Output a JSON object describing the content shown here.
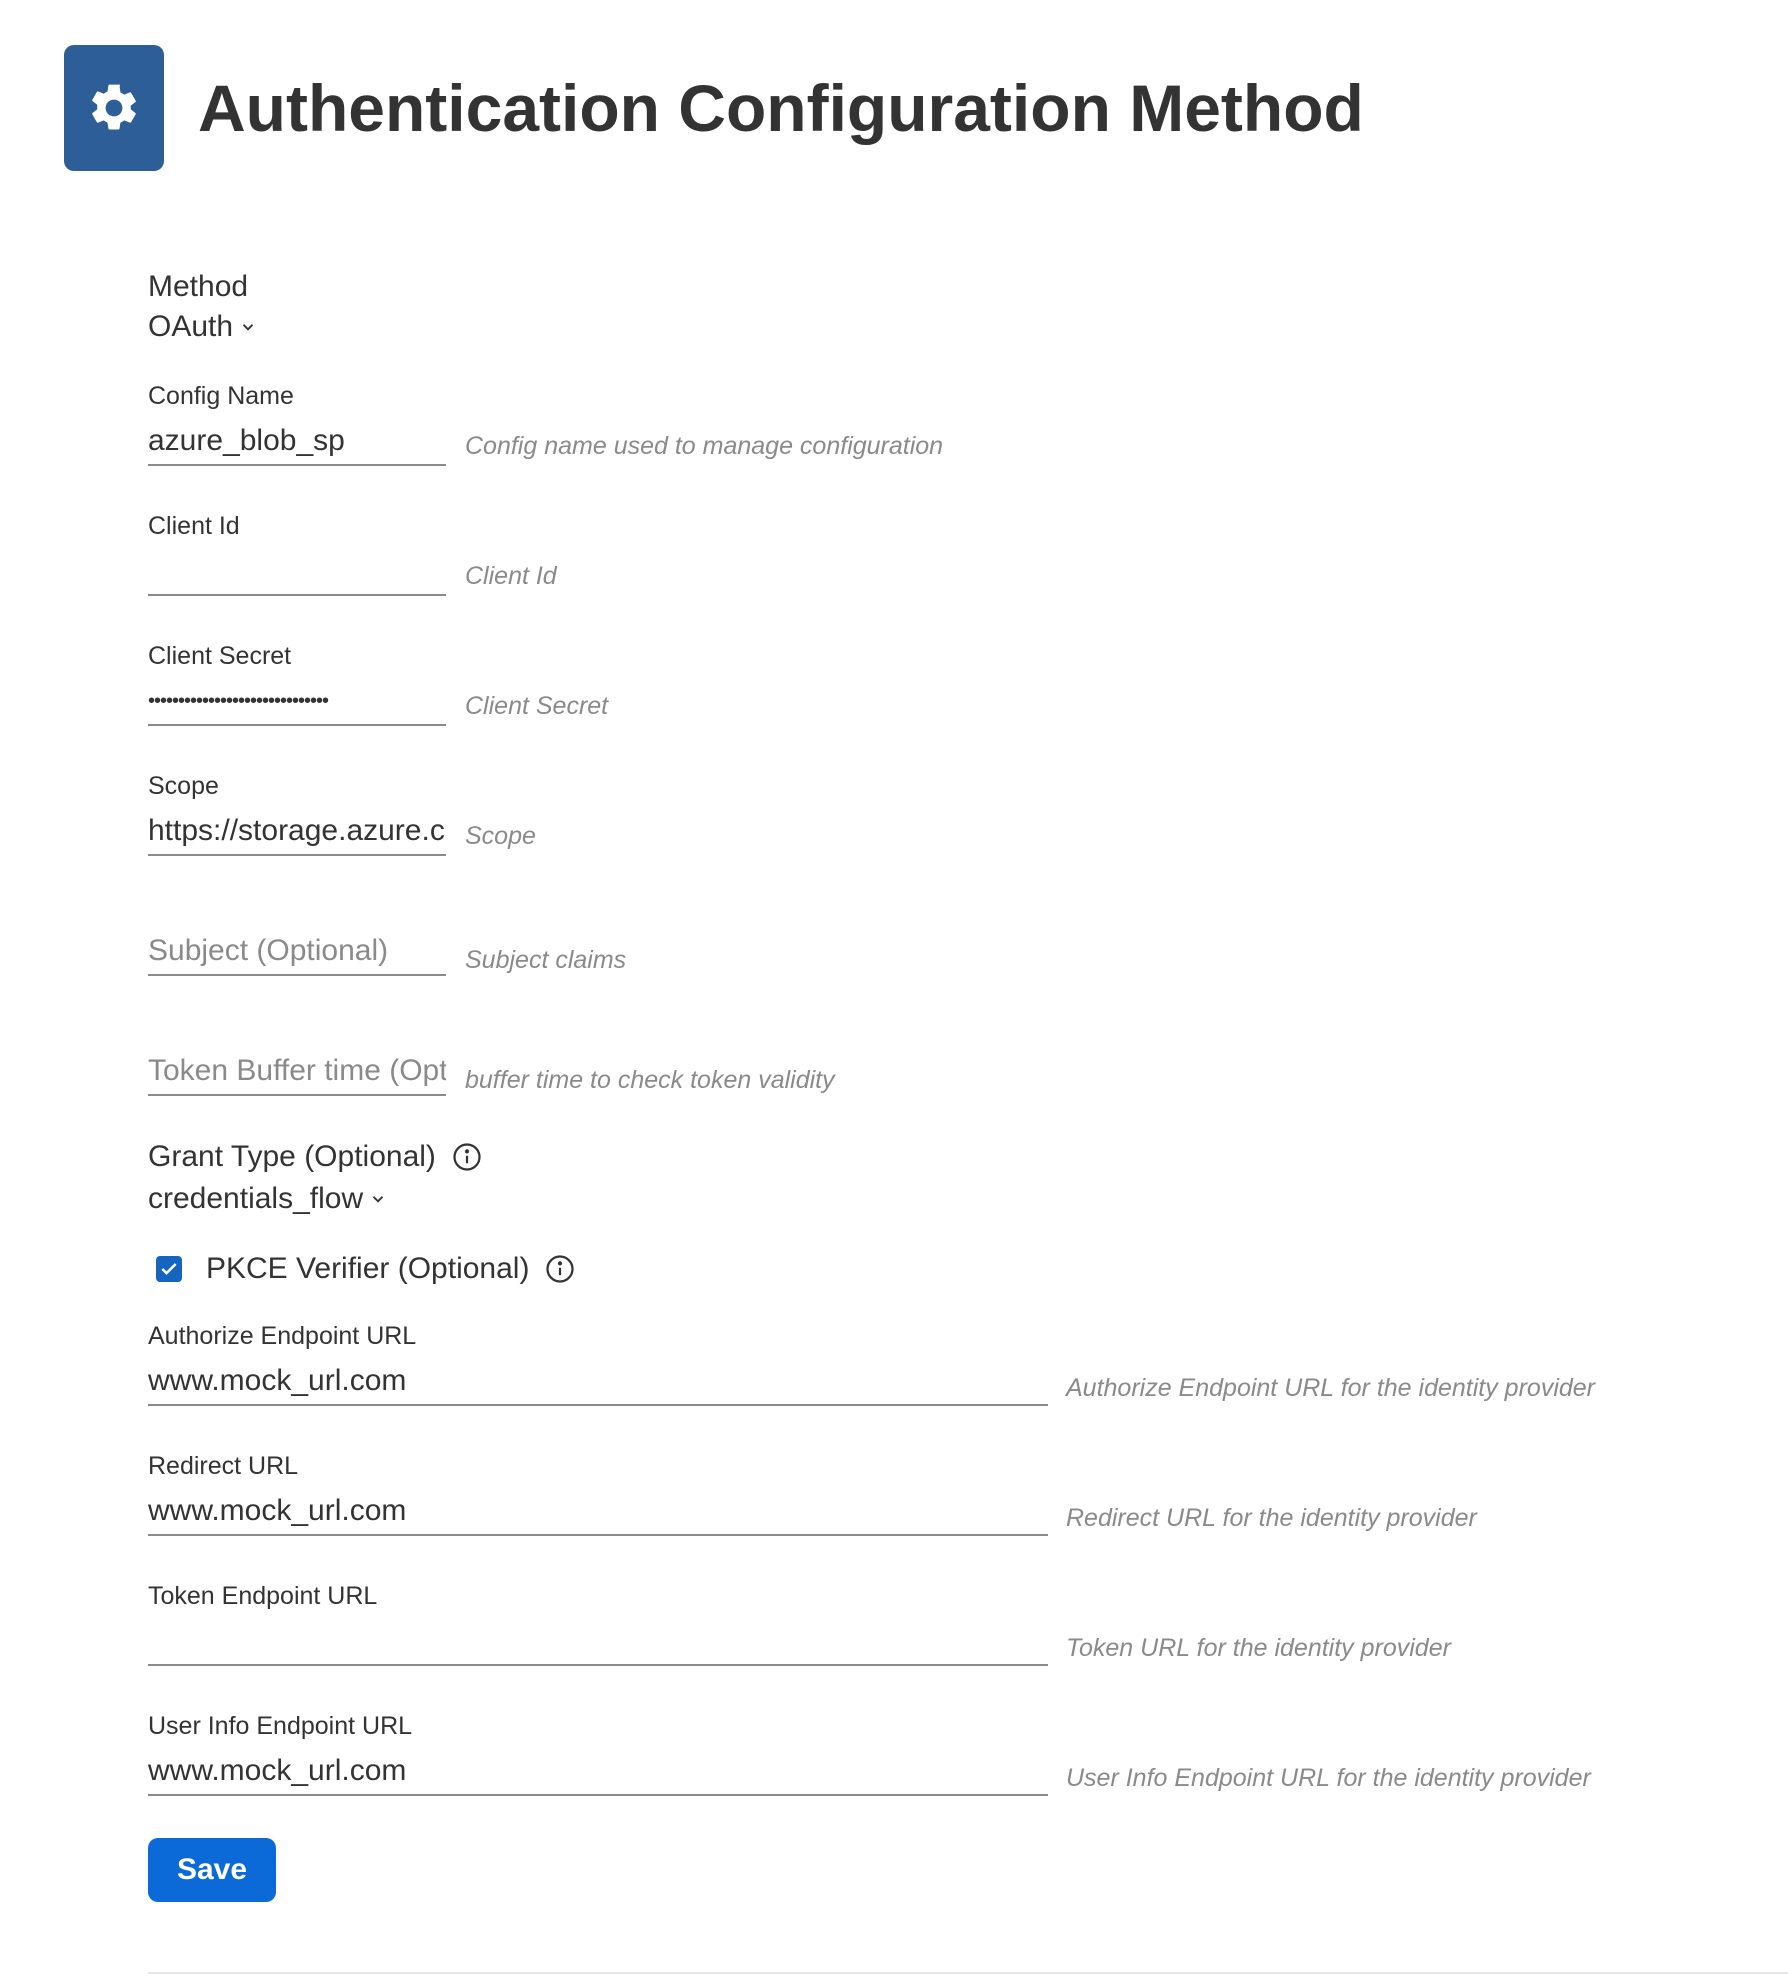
{
  "header": {
    "title": "Authentication Configuration Method",
    "icon": "gear-icon",
    "icon_bg": "#2e5e98"
  },
  "method": {
    "label": "Method",
    "value": "OAuth"
  },
  "config_name": {
    "label": "Config Name",
    "value": "azure_blob_sp",
    "hint": "Config name used to manage configuration"
  },
  "client_id": {
    "label": "Client Id",
    "value": "",
    "hint": "Client Id"
  },
  "client_secret": {
    "label": "Client Secret",
    "value": "••••••••••••••••••••••••••••••",
    "hint": "Client Secret"
  },
  "scope": {
    "label": "Scope",
    "value": "https://storage.azure.com/.default",
    "hint": "Scope"
  },
  "subject": {
    "placeholder": "Subject (Optional)",
    "hint": "Subject claims"
  },
  "token_buffer": {
    "placeholder": "Token Buffer time (Optional)",
    "hint": "buffer time to check token validity"
  },
  "grant_type": {
    "label": "Grant Type (Optional)",
    "value": "credentials_flow"
  },
  "pkce": {
    "label": "PKCE Verifier (Optional)",
    "checked": true
  },
  "authorize_url": {
    "label": "Authorize Endpoint URL",
    "value": "www.mock_url.com",
    "hint": "Authorize Endpoint URL for the identity provider"
  },
  "redirect_url": {
    "label": "Redirect URL",
    "value": "www.mock_url.com",
    "hint": "Redirect URL for the identity provider"
  },
  "token_url": {
    "label": "Token Endpoint URL",
    "value": "",
    "hint": "Token URL for the identity provider"
  },
  "user_info_url": {
    "label": "User Info Endpoint URL",
    "value": "www.mock_url.com",
    "hint": "User Info Endpoint URL for the identity provider"
  },
  "actions": {
    "save_label": "Save"
  },
  "colors": {
    "accent": "#0c6ad8",
    "checkbox": "#1565c0",
    "text": "#333333",
    "muted": "#8a8a8a"
  }
}
